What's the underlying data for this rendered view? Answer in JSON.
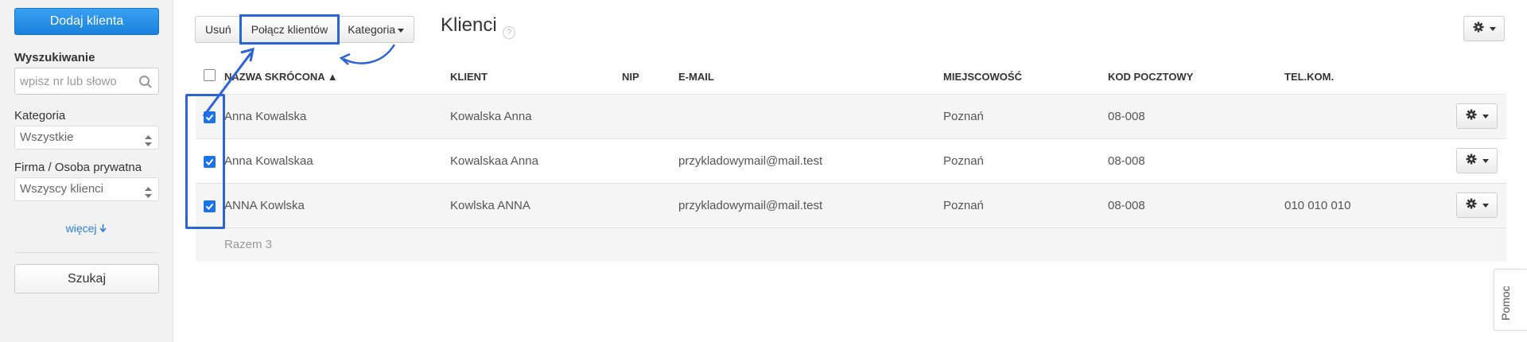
{
  "sidebar": {
    "add_client_label": "Dodaj klienta",
    "search_label": "Wyszukiwanie",
    "search_placeholder": "wpisz nr lub słowo",
    "category_label": "Kategoria",
    "category_value": "Wszystkie",
    "company_label": "Firma / Osoba prywatna",
    "company_value": "Wszyscy klienci",
    "more_label": "więcej",
    "search_button_label": "Szukaj"
  },
  "toolbar": {
    "delete_label": "Usuń",
    "merge_label": "Połącz klientów",
    "category_label": "Kategoria"
  },
  "page": {
    "title": "Klienci",
    "help_glyph": "?"
  },
  "table": {
    "columns": [
      "NAZWA SKRÓCONA ▲",
      "KLIENT",
      "NIP",
      "E-MAIL",
      "MIEJSCOWOŚĆ",
      "KOD POCZTOWY",
      "TEL.KOM."
    ],
    "rows": [
      {
        "name": "Anna Kowalska",
        "client": "Kowalska Anna",
        "nip": "",
        "email": "",
        "city": "Poznań",
        "postal": "08-008",
        "phone": "",
        "checked": true
      },
      {
        "name": "Anna Kowalskaa",
        "client": "Kowalskaa Anna",
        "nip": "",
        "email": "przykladowymail@mail.test",
        "city": "Poznań",
        "postal": "08-008",
        "phone": "",
        "checked": true
      },
      {
        "name": "ANNA Kowlska",
        "client": "Kowlska ANNA",
        "nip": "",
        "email": "przykladowymail@mail.test",
        "city": "Poznań",
        "postal": "08-008",
        "phone": "010 010 010",
        "checked": true
      }
    ],
    "total_label": "Razem 3"
  },
  "help_tab_label": "Pomoc",
  "colors": {
    "accent": "#1a82dc",
    "highlight": "#2b63d9",
    "checkbox": "#1a73e8"
  }
}
